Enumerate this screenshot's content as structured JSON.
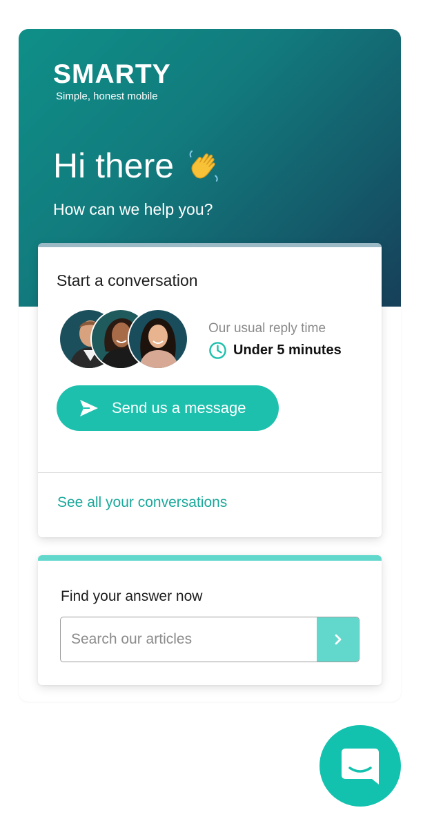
{
  "brand": {
    "name": "SMARTY",
    "tagline": "Simple, honest mobile"
  },
  "hero": {
    "greeting": "Hi there",
    "greeting_icon": "waving-hand-icon",
    "subtitle": "How can we help you?"
  },
  "conversation_card": {
    "title": "Start a conversation",
    "reply_label": "Our usual reply time",
    "reply_time": "Under 5 minutes",
    "reply_icon": "clock-icon",
    "send_button_label": "Send us a message",
    "send_icon": "paper-plane-icon",
    "see_all_link": "See all your conversations"
  },
  "search_card": {
    "title": "Find your answer now",
    "placeholder": "Search our articles",
    "submit_icon": "chevron-right-icon"
  },
  "launcher": {
    "icon": "chat-bubble-icon"
  },
  "colors": {
    "accent": "#1dc0ad",
    "accent_light": "#62d8cd",
    "link": "#1aa89a",
    "hero_start": "#0f8f88",
    "hero_end": "#173f59"
  }
}
